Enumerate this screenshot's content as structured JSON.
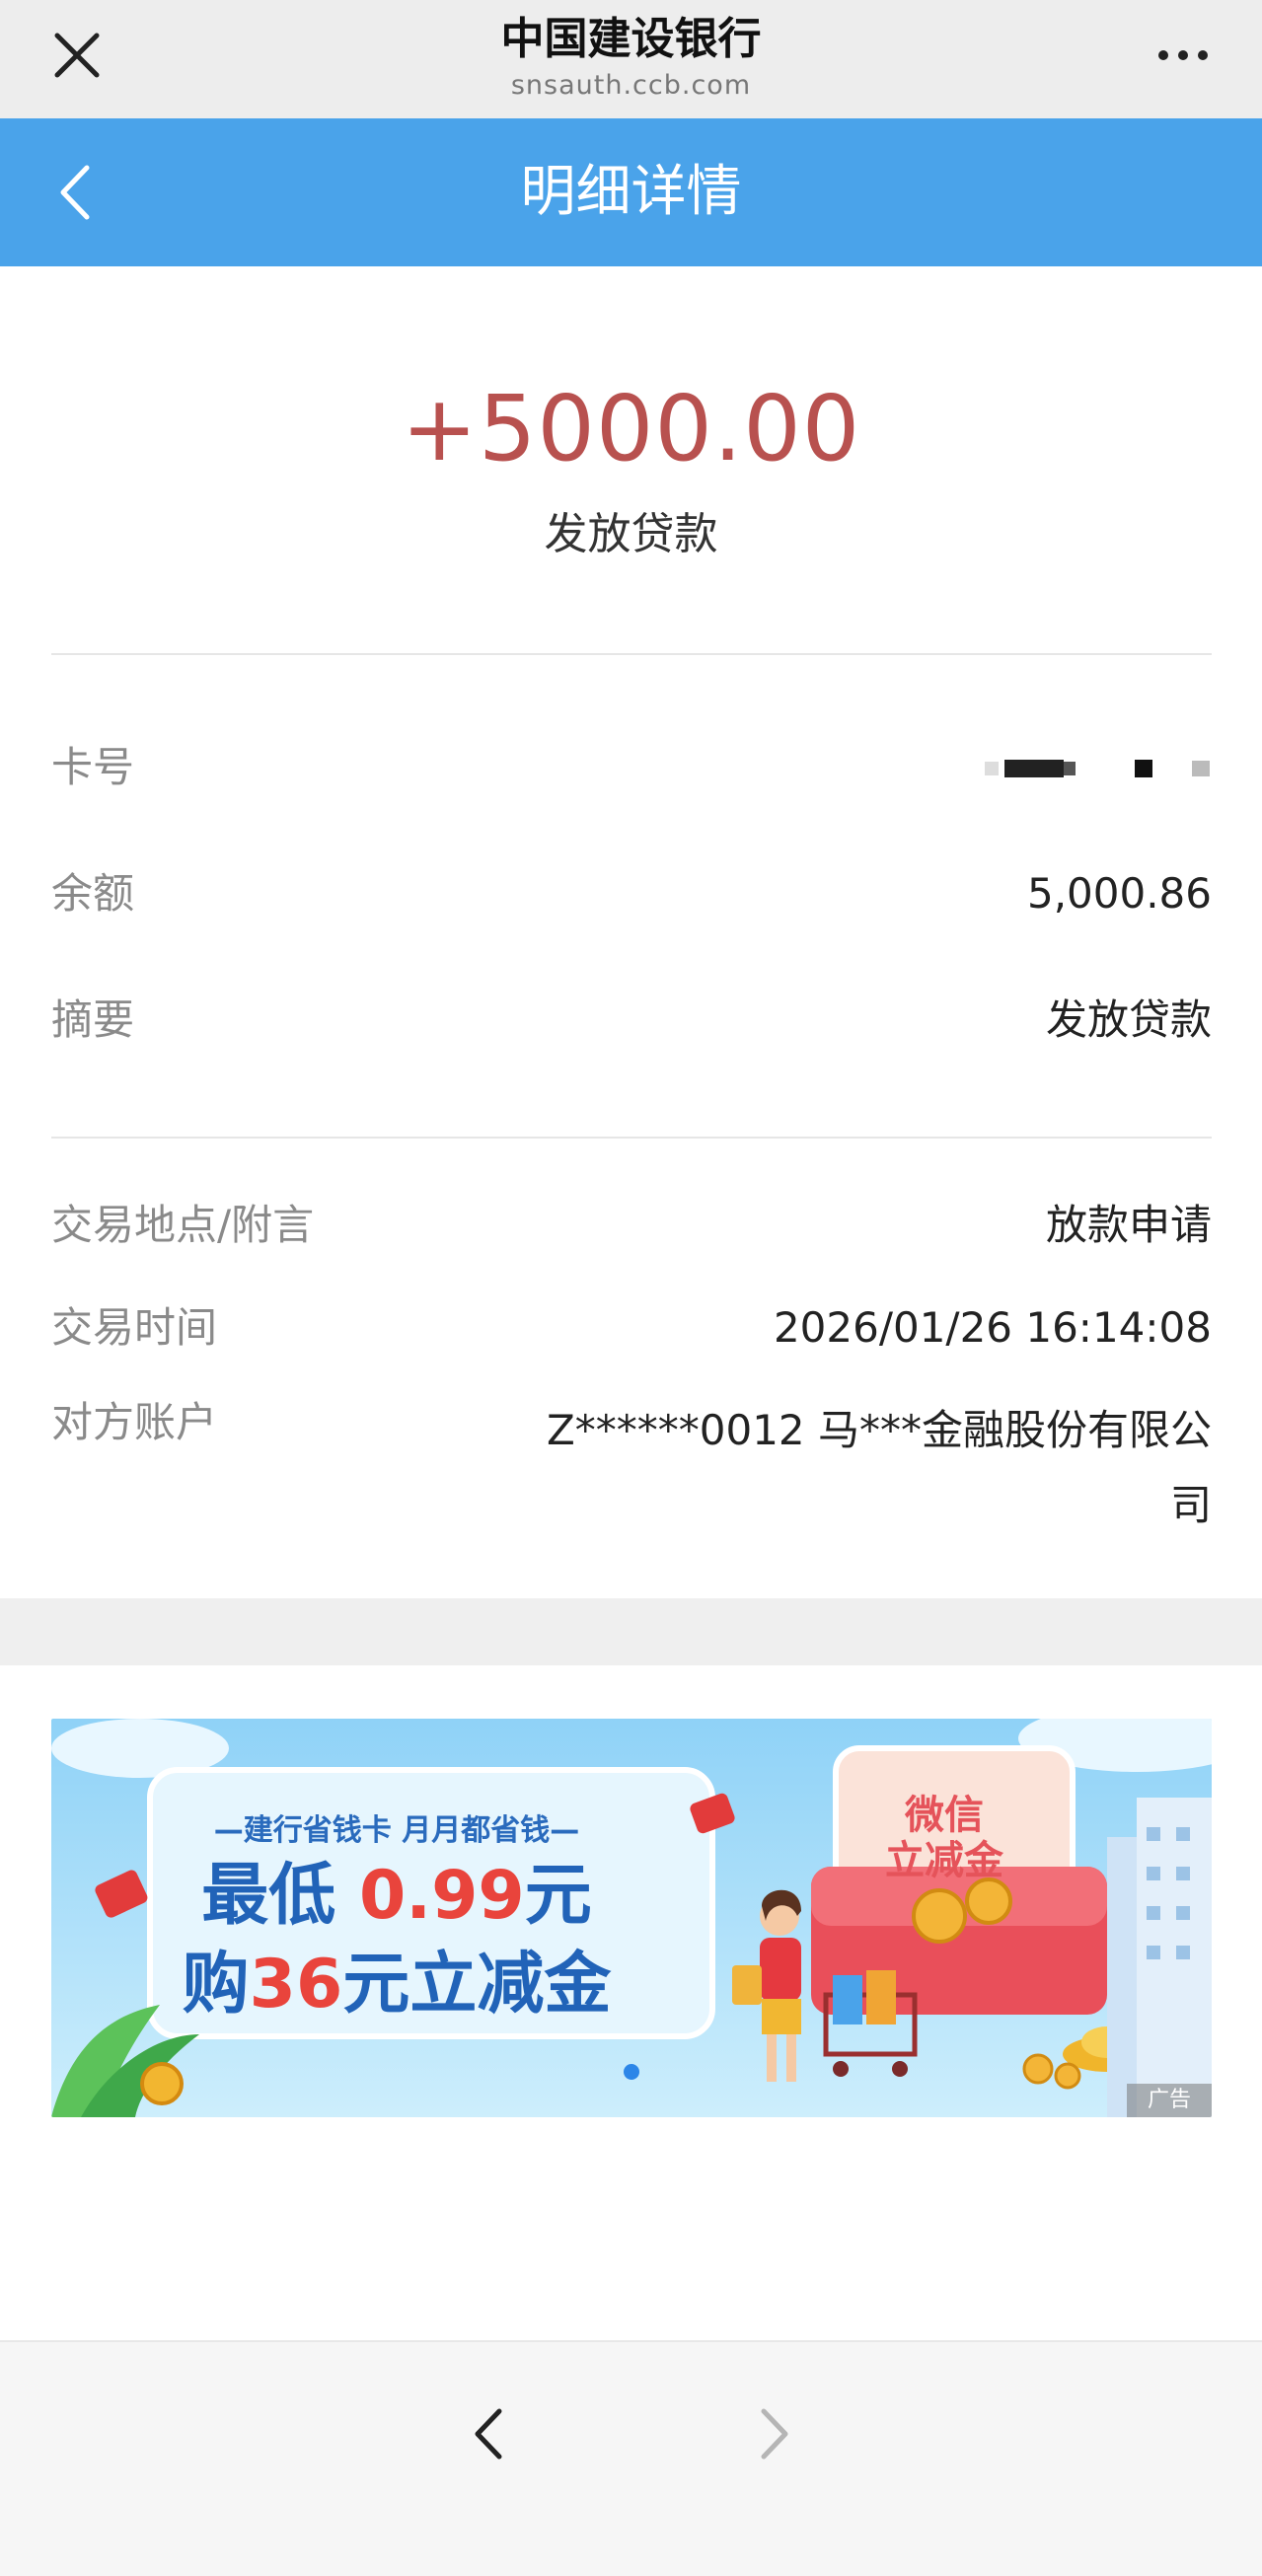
{
  "browser": {
    "title": "中国建设银行",
    "url": "snsauth.ccb.com"
  },
  "header": {
    "title": "明细详情"
  },
  "transaction": {
    "amount": "+5000.00",
    "type": "发放贷款"
  },
  "details": [
    {
      "label": "卡号",
      "value": ""
    },
    {
      "label": "余额",
      "value": "5,000.86"
    },
    {
      "label": "摘要",
      "value": "发放贷款"
    },
    {
      "label": "交易地点/附言",
      "value": "放款申请"
    },
    {
      "label": "交易时间",
      "value": "2026/01/26 16:14:08"
    },
    {
      "label": "对方账户",
      "value": "Z******0012 马***金融股份有限公司"
    }
  ],
  "banner": {
    "tagline": "—建行省钱卡 月月都省钱—",
    "line1_a": "最低 ",
    "line1_hl": "0.99",
    "line1_b": "元",
    "line2_a": "购",
    "line2_hl": "36",
    "line2_b": "元立减金",
    "card_text_1": "微信",
    "card_text_2": "立减金",
    "ad_label": "广告"
  },
  "colors": {
    "header_bg": "#4aa3ea",
    "amount": "#b8514f",
    "banner_accent": "#e9443c"
  }
}
